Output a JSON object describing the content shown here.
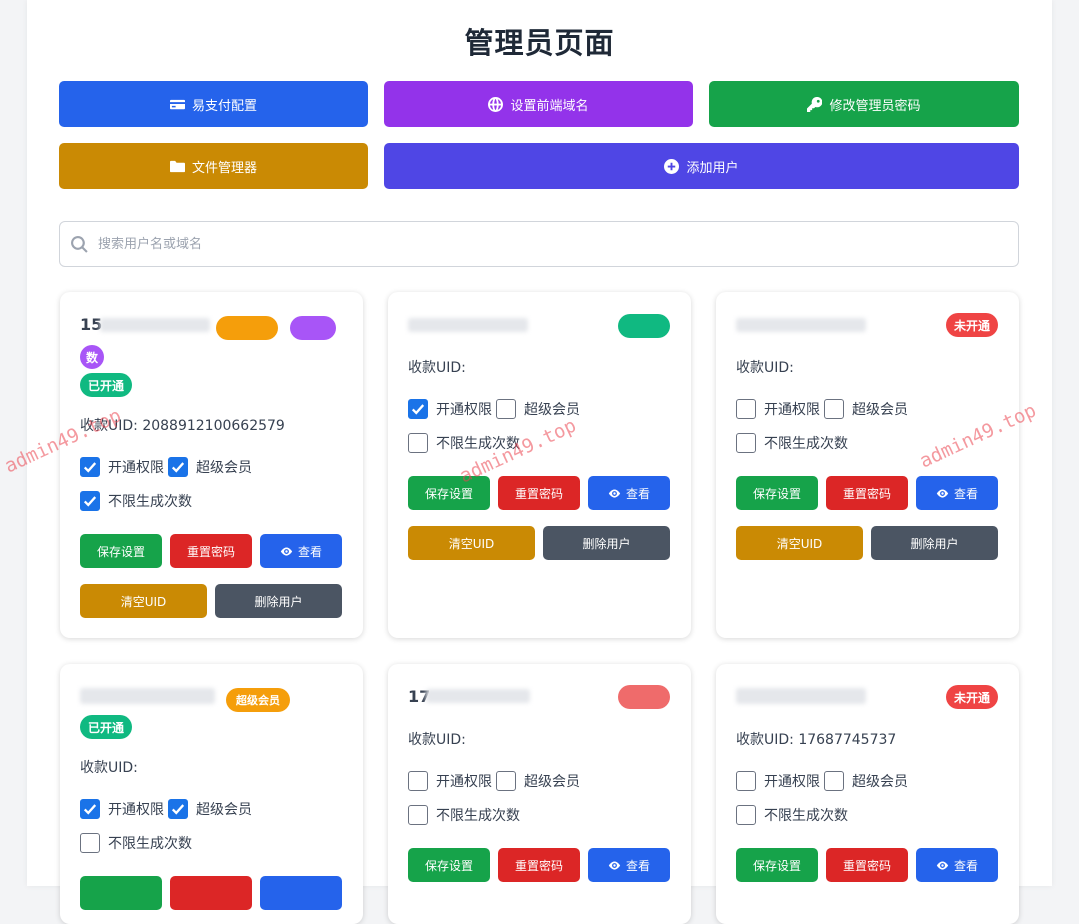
{
  "page": {
    "title": "管理员页面"
  },
  "actions": {
    "payment_config": "易支付配置",
    "frontend_domain": "设置前端域名",
    "change_password": "修改管理员密码",
    "file_manager": "文件管理器",
    "add_user": "添加用户"
  },
  "search": {
    "placeholder": "搜索用户名或域名"
  },
  "labels": {
    "uid_prefix": "收款UID:",
    "perm": "开通权限",
    "super": "超级会员",
    "unlimited": "不限生成次数",
    "save": "保存设置",
    "reset": "重置密码",
    "view": "查看",
    "clear_uid": "清空UID",
    "delete": "删除用户"
  },
  "cards": [
    {
      "username": "15",
      "uid_value": "2088912100662579",
      "status": "已开通",
      "status_color": "#10b981",
      "extra_badges": [
        "",
        "",
        "数"
      ],
      "perm": true,
      "super": true,
      "unlimited": true
    },
    {
      "username": "",
      "uid_value": "",
      "status": "",
      "status_color": "#10b981",
      "perm": true,
      "super": false,
      "unlimited": false
    },
    {
      "username": "",
      "uid_value": "",
      "status": "未开通",
      "status_color": "#ef4444",
      "perm": false,
      "super": false,
      "unlimited": false
    },
    {
      "username": "",
      "uid_value": "",
      "status": "已开通",
      "status_color": "#10b981",
      "extra_badges": [
        "超级会员"
      ],
      "perm": true,
      "super": true,
      "unlimited": false
    },
    {
      "username": "17",
      "uid_value": "",
      "status": "",
      "status_color": "#ef4444",
      "perm": false,
      "super": false,
      "unlimited": false
    },
    {
      "username": "",
      "uid_value": "17687745737",
      "status": "未开通",
      "status_color": "#ef4444",
      "perm": false,
      "super": false,
      "unlimited": false
    }
  ],
  "watermark": "admin49.top"
}
